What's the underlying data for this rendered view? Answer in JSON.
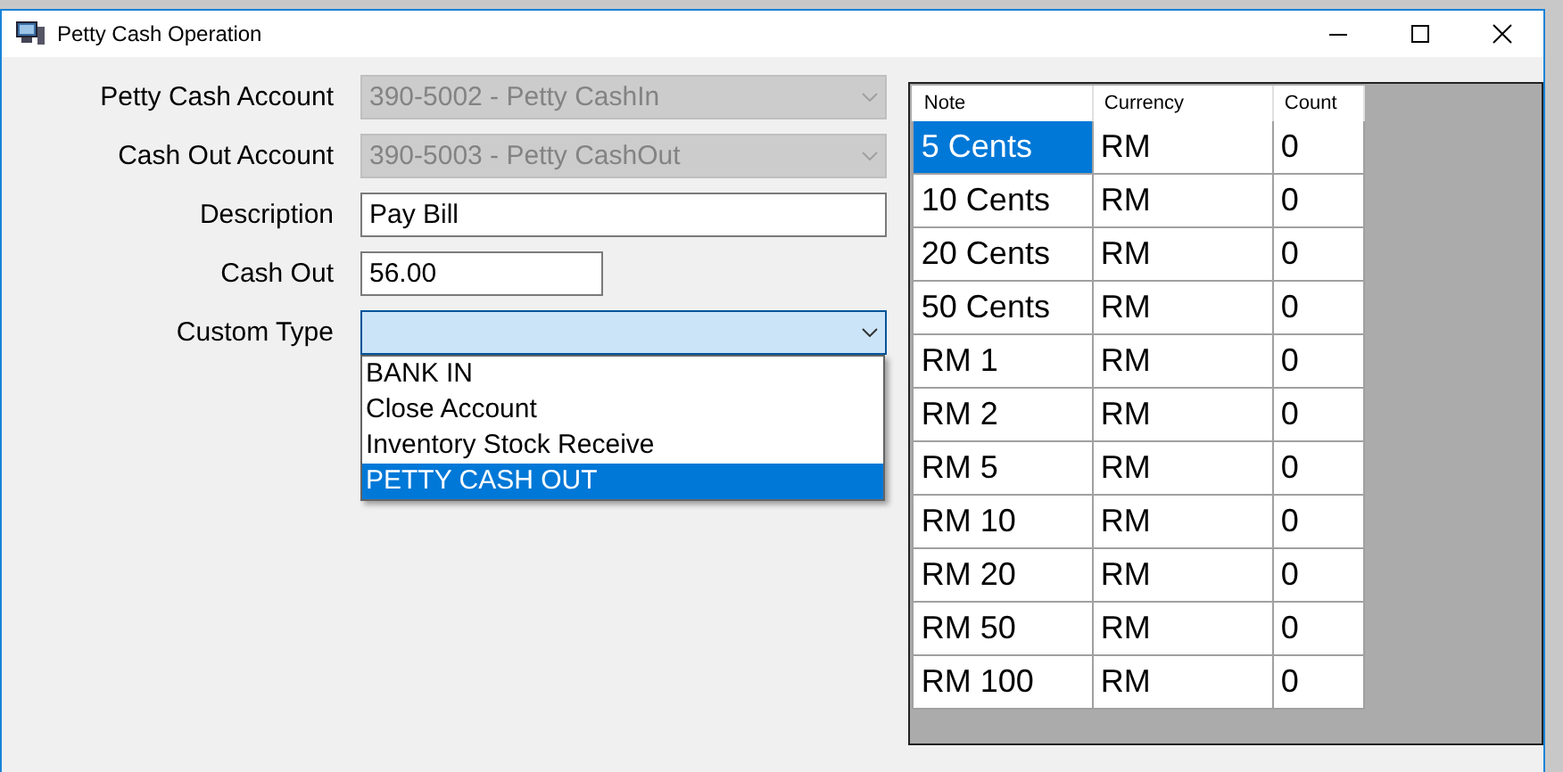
{
  "window": {
    "title": "Petty Cash Operation"
  },
  "form": {
    "fields": [
      {
        "kind": "combo",
        "label": "Petty Cash Account",
        "value": "390-5002 - Petty CashIn",
        "disabled": true
      },
      {
        "kind": "combo",
        "label": "Cash Out Account",
        "value": "390-5003 - Petty CashOut",
        "disabled": true
      },
      {
        "kind": "text",
        "label": "Description",
        "value": "Pay Bill"
      },
      {
        "kind": "amount",
        "label": "Cash Out",
        "value": "56.00"
      },
      {
        "kind": "combo",
        "label": "Custom Type",
        "disabled": false,
        "expanded": true,
        "options": [
          {
            "label": "BANK IN",
            "selected": false
          },
          {
            "label": "Close Account",
            "selected": false
          },
          {
            "label": "Inventory Stock Receive",
            "selected": false
          },
          {
            "label": "PETTY CASH OUT",
            "selected": true
          }
        ]
      }
    ]
  },
  "grid": {
    "columns": [
      "Note",
      "Currency",
      "Count"
    ],
    "rows": [
      {
        "note": "5 Cents",
        "currency": "RM",
        "count": "0",
        "selected": true
      },
      {
        "note": "10 Cents",
        "currency": "RM",
        "count": "0",
        "selected": false
      },
      {
        "note": "20 Cents",
        "currency": "RM",
        "count": "0",
        "selected": false
      },
      {
        "note": "50 Cents",
        "currency": "RM",
        "count": "0",
        "selected": false
      },
      {
        "note": "RM 1",
        "currency": "RM",
        "count": "0",
        "selected": false
      },
      {
        "note": "RM 2",
        "currency": "RM",
        "count": "0",
        "selected": false
      },
      {
        "note": "RM 5",
        "currency": "RM",
        "count": "0",
        "selected": false
      },
      {
        "note": "RM 10",
        "currency": "RM",
        "count": "0",
        "selected": false
      },
      {
        "note": "RM 20",
        "currency": "RM",
        "count": "0",
        "selected": false
      },
      {
        "note": "RM 50",
        "currency": "RM",
        "count": "0",
        "selected": false
      },
      {
        "note": "RM 100",
        "currency": "RM",
        "count": "0",
        "selected": false
      }
    ]
  }
}
